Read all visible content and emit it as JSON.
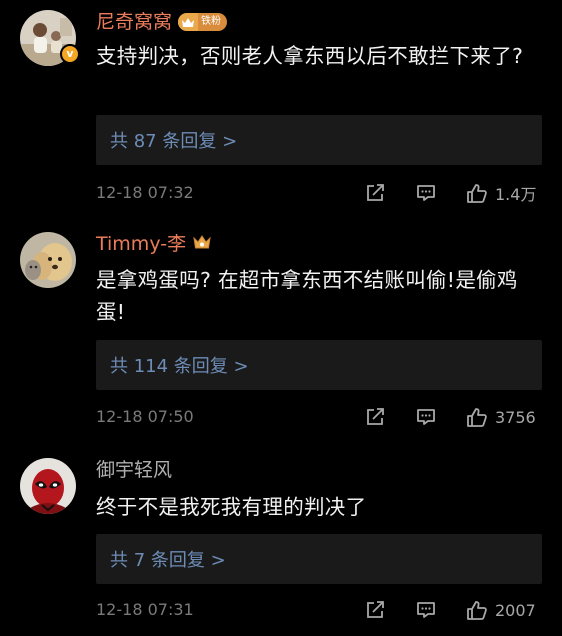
{
  "comments": [
    {
      "username": "尼奇窝窝",
      "fan_badge": "铁粉",
      "verified_mark": "v",
      "text": "支持判决，否则老人拿东西以后不敢拦下来了?",
      "replies": "共 87 条回复 >",
      "timestamp": "12-18 07:32",
      "likes": "1.4万"
    },
    {
      "username": "Timmy-李",
      "text": "是拿鸡蛋吗? 在超市拿东西不结账叫偷!是偷鸡蛋!",
      "replies": "共 114 条回复 >",
      "timestamp": "12-18 07:50",
      "likes": "3756"
    },
    {
      "username": "御宇轻风",
      "text": "终于不是我死我有理的判决了",
      "replies": "共 7 条回复 >",
      "timestamp": "12-18 07:31",
      "likes": "2007"
    }
  ],
  "icons": {
    "share": "share-icon",
    "comment": "comment-icon",
    "like": "thumbs-up-icon",
    "crown": "crown-icon"
  },
  "colors": {
    "background": "#000000",
    "vip_name": "#ea7d5a",
    "plain_name": "#b0b0b0",
    "reply_link": "#6d8cb6",
    "meta": "#7a7a7a",
    "reply_box": "#1a1a1a"
  }
}
